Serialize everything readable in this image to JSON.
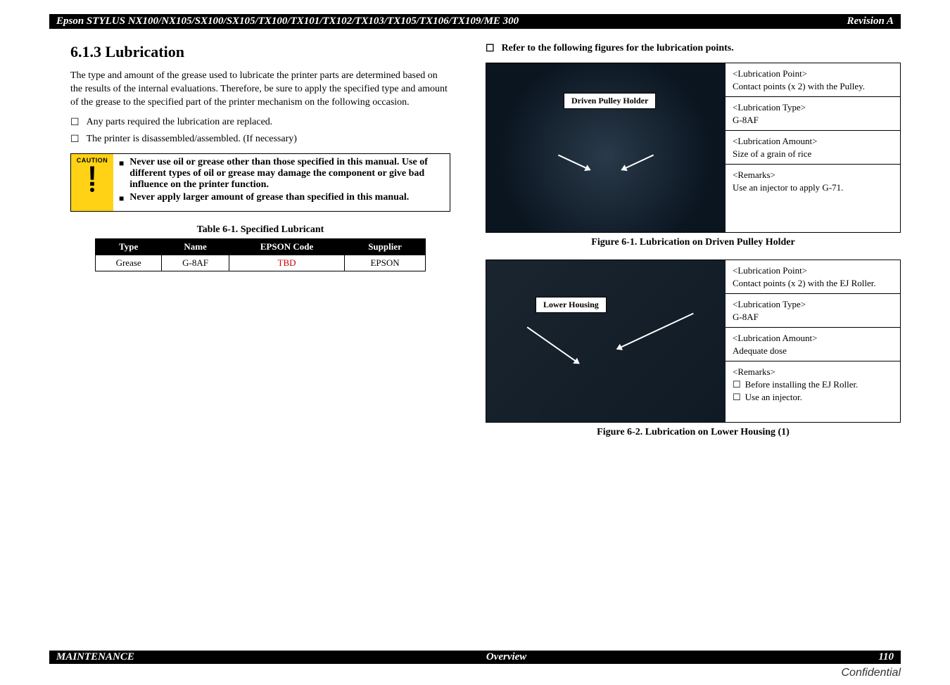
{
  "header": {
    "title_left": "Epson STYLUS NX100/NX105/SX100/SX105/TX100/TX101/TX102/TX103/TX105/TX106/TX109/ME 300",
    "title_right": "Revision A"
  },
  "left": {
    "section_number_title": "6.1.3  Lubrication",
    "intro": "The type and amount of the grease used to lubricate the printer parts are determined based on the results of the internal evaluations. Therefore, be sure to apply the specified type and amount of the grease to the specified part of the printer mechanism on the following occasion.",
    "bullets": [
      "Any parts required the lubrication are replaced.",
      "The printer is disassembled/assembled. (If necessary)"
    ],
    "caution": {
      "label": "CAUTION",
      "items": [
        "Never use oil or grease other than those specified in this manual. Use of different types of oil or grease may damage the component or give bad influence on the printer function.",
        "Never apply larger amount of grease than specified in this manual."
      ]
    },
    "table_title": "Table 6-1.  Specified Lubricant",
    "table": {
      "headers": [
        "Type",
        "Name",
        "EPSON Code",
        "Supplier"
      ],
      "row": {
        "type": "Grease",
        "name": "G-8AF",
        "code": "TBD",
        "supplier": "EPSON"
      }
    }
  },
  "right": {
    "lead_bullet": "Refer to the following figures for the lubrication points.",
    "fig1": {
      "callout": "Driven Pulley Holder",
      "info": [
        {
          "head": "<Lubrication Point>",
          "body": "Contact points (x 2) with the Pulley."
        },
        {
          "head": "<Lubrication Type>",
          "body": "G-8AF"
        },
        {
          "head": "<Lubrication Amount>",
          "body": "Size of a grain of rice"
        },
        {
          "head": "<Remarks>",
          "body": "Use an injector to apply G-71."
        }
      ],
      "caption": "Figure 6-1.  Lubrication on Driven Pulley Holder"
    },
    "fig2": {
      "callout": "Lower Housing",
      "info": [
        {
          "head": "<Lubrication Point>",
          "body": "Contact points (x 2) with the EJ Roller."
        },
        {
          "head": "<Lubrication Type>",
          "body": "G-8AF"
        },
        {
          "head": "<Lubrication Amount>",
          "body": "Adequate dose"
        },
        {
          "head": "<Remarks>",
          "sub": [
            "Before installing the EJ Roller.",
            "Use an injector."
          ]
        }
      ],
      "caption": "Figure 6-2.  Lubrication on Lower Housing (1)"
    }
  },
  "footer": {
    "left": "MAINTENANCE",
    "center": "Overview",
    "right": "110"
  },
  "confidential": "Confidential"
}
